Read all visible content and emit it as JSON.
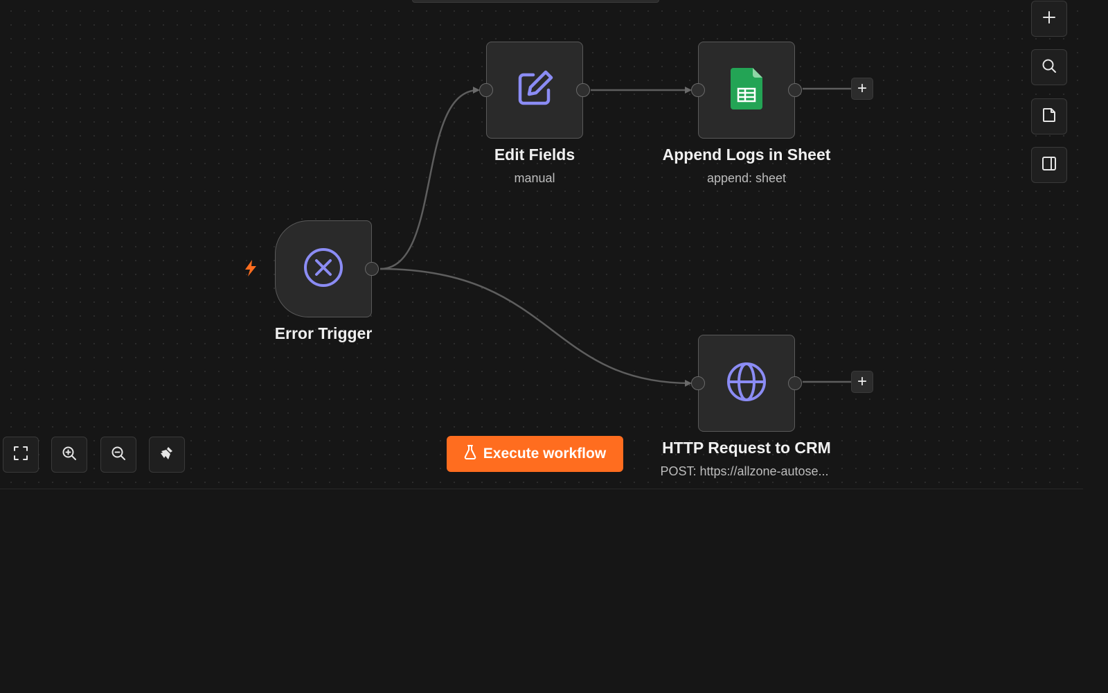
{
  "nodes": {
    "error_trigger": {
      "title": "Error Trigger",
      "icon": "error-circle-icon"
    },
    "edit_fields": {
      "title": "Edit Fields",
      "subtitle": "manual",
      "icon": "edit-icon"
    },
    "append_logs": {
      "title": "Append Logs in Sheet",
      "subtitle": "append: sheet",
      "icon": "google-sheets-icon"
    },
    "http_request": {
      "title": "HTTP Request to CRM",
      "subtitle": "POST: https://allzone-autose...",
      "icon": "globe-icon"
    }
  },
  "toolbar": {
    "execute_label": "Execute workflow",
    "add_plus": "+"
  },
  "colors": {
    "accent": "#ff6d1f",
    "icon_purple": "#8b8cf4",
    "sheets_green": "#23a455",
    "trigger_bolt": "#ff6d1f"
  }
}
